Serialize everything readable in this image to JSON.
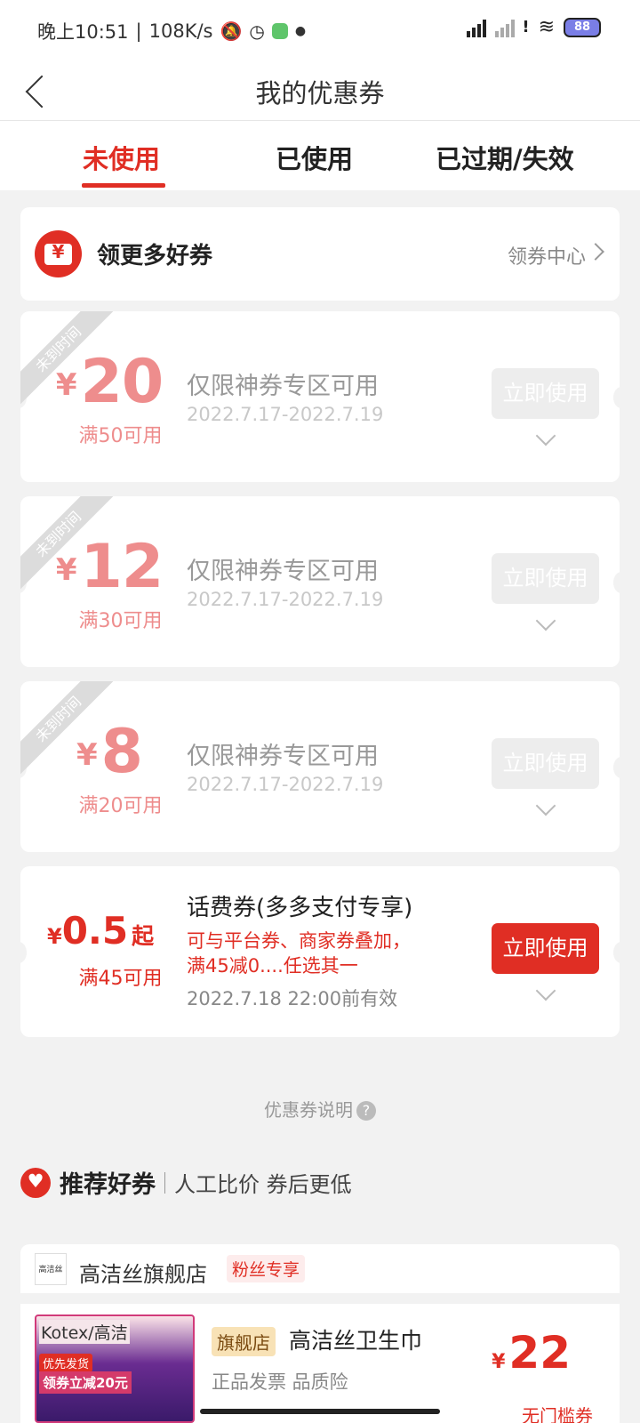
{
  "status_bar": {
    "time": "晚上10:51",
    "separator": "|",
    "speed": "108K/s",
    "battery": "88"
  },
  "header": {
    "title": "我的优惠券"
  },
  "tabs": [
    {
      "label": "未使用"
    },
    {
      "label": "已使用"
    },
    {
      "label": "已过期/失效"
    }
  ],
  "promo": {
    "title": "领更多好券",
    "link": "领券中心",
    "icon_text": "¥"
  },
  "coupons": [
    {
      "ribbon": "未到时间",
      "currency": "¥",
      "amount": "20",
      "condition": "满50可用",
      "title": "仅限神券专区可用",
      "date": "2022.7.17-2022.7.19",
      "button": "立即使用"
    },
    {
      "ribbon": "未到时间",
      "currency": "¥",
      "amount": "12",
      "condition": "满30可用",
      "title": "仅限神券专区可用",
      "date": "2022.7.17-2022.7.19",
      "button": "立即使用"
    },
    {
      "ribbon": "未到时间",
      "currency": "¥",
      "amount": "8",
      "condition": "满20可用",
      "title": "仅限神券专区可用",
      "date": "2022.7.17-2022.7.19",
      "button": "立即使用"
    }
  ],
  "phone_coupon": {
    "currency": "¥",
    "amount": "0.5",
    "suffix": "起",
    "condition": "满45可用",
    "title": "话费券(多多支付专享)",
    "desc_line1": "可与平台券、商家券叠加，",
    "desc_line2": "满45减0....任选其一",
    "date": "2022.7.18 22:00前有效",
    "button": "立即使用"
  },
  "explain": {
    "label": "优惠券说明",
    "icon": "?"
  },
  "recommend": {
    "title": "推荐好券",
    "subtitle": "人工比价 券后更低"
  },
  "store": {
    "logo_text": "高洁丝",
    "name": "高洁丝旗舰店",
    "tag": "粉丝专享"
  },
  "product": {
    "img_brand": "Kotex/高洁",
    "img_badge": "优先发货",
    "img_promo": "领券立减20元",
    "tag": "旗舰店",
    "name": "高洁丝卫生巾",
    "meta": "正品发票 品质险",
    "currency": "¥",
    "price": "22",
    "cut_text": "无门槛券"
  }
}
